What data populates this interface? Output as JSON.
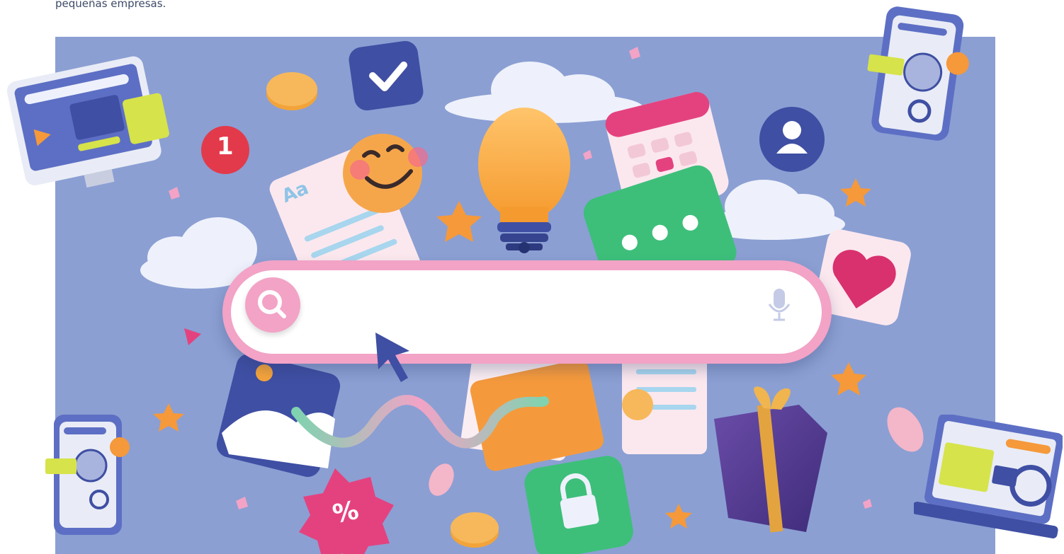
{
  "caption": {
    "text": "pequeñas empresas."
  },
  "search_bar": {
    "value": "",
    "placeholder": ""
  },
  "decorations": {
    "notification_badge": "1",
    "discount_badge": "%",
    "text_doc_label": "Aa"
  },
  "colors": {
    "background": "#8b9fd3",
    "search_frame": "#f2a3c6",
    "search_field": "#ffffff",
    "accent_pink": "#e4427f",
    "accent_blue": "#3f4fa3",
    "accent_orange": "#f5a43a",
    "accent_green": "#3dbf7a",
    "cloud": "#eef1fb"
  },
  "icons": {
    "search": "search-icon",
    "mic": "microphone-icon",
    "cursor": "cursor-icon",
    "check": "checkmark-icon",
    "bulb": "lightbulb-icon",
    "user": "user-icon",
    "heart": "heart-icon",
    "lock": "lock-icon",
    "gift": "gift-icon",
    "calendar": "calendar-icon",
    "chat": "chat-bubble-icon",
    "coin": "coin-icon",
    "smiley": "smiley-emoji-icon",
    "globe": "globe-icon",
    "location": "location-pin-icon",
    "star": "star-icon"
  }
}
